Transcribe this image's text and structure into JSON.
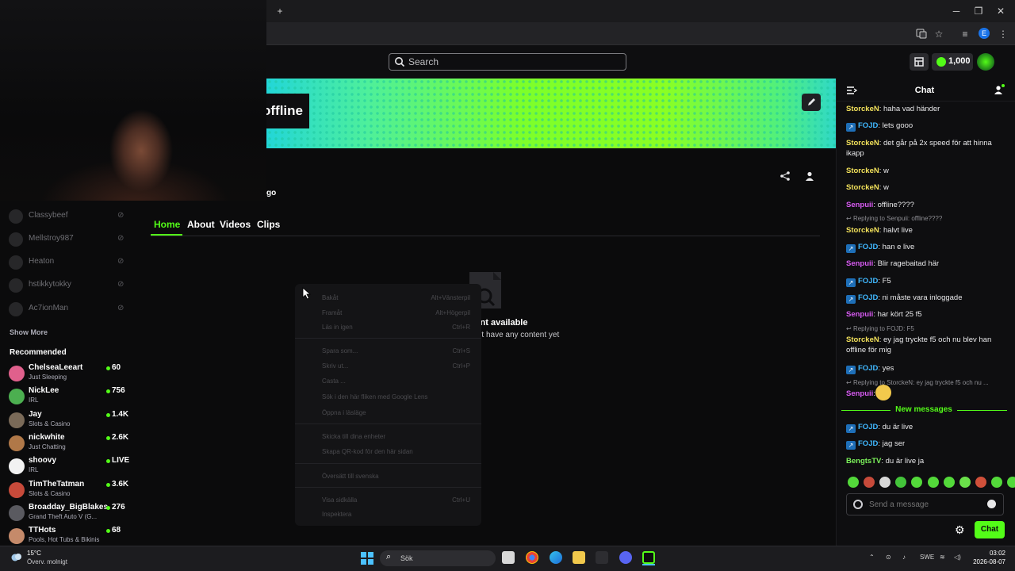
{
  "browser": {
    "new_tab": "+",
    "min": "─",
    "max": "❐",
    "close": "✕",
    "profile_initial": "E"
  },
  "header": {
    "search_placeholder": "Search",
    "balance": "1,000"
  },
  "channel": {
    "offline_label": "offline",
    "about_fragment": "go",
    "tabs": [
      "Home",
      "About",
      "Videos",
      "Clips"
    ],
    "empty_title": "No content available",
    "empty_subtitle": "This channel doesn't have any content yet"
  },
  "context_menu": {
    "items": [
      {
        "label": "Bakåt",
        "shortcut": "Alt+Vänsterpil"
      },
      {
        "label": "Framåt",
        "shortcut": "Alt+Högerpil"
      },
      {
        "label": "Läs in igen",
        "shortcut": "Ctrl+R"
      },
      {
        "label": "Spara som...",
        "shortcut": "Ctrl+S"
      },
      {
        "label": "Skriv ut...",
        "shortcut": "Ctrl+P"
      },
      {
        "label": "Casta ...",
        "shortcut": ""
      },
      {
        "label": "Sök i den här fliken med Google Lens",
        "shortcut": ""
      },
      {
        "label": "Öppna i läsläge",
        "shortcut": ""
      },
      {
        "label": "Skicka till dina enheter",
        "shortcut": ""
      },
      {
        "label": "Skapa QR-kod för den här sidan",
        "shortcut": ""
      },
      {
        "label": "Översätt till svenska",
        "shortcut": ""
      },
      {
        "label": "Visa sidkälla",
        "shortcut": "Ctrl+U"
      },
      {
        "label": "Inspektera",
        "shortcut": ""
      }
    ]
  },
  "sidebar": {
    "following": [
      {
        "name": "Classybeef"
      },
      {
        "name": "Mellstroy987"
      },
      {
        "name": "Heaton"
      },
      {
        "name": "hstikkytokky"
      },
      {
        "name": "Ac7ionMan"
      }
    ],
    "show_more": "Show More",
    "recommended_title": "Recommended",
    "recommended": [
      {
        "name": "ChelseaLeeart",
        "category": "Just Sleeping",
        "viewers": "60",
        "color": "#e0608c"
      },
      {
        "name": "NickLee",
        "category": "IRL",
        "viewers": "756",
        "color": "#4caf50"
      },
      {
        "name": "Jay",
        "category": "Slots & Casino",
        "viewers": "1.4K",
        "color": "#7a6a58"
      },
      {
        "name": "nickwhite",
        "category": "Just Chatting",
        "viewers": "2.6K",
        "color": "#b07848"
      },
      {
        "name": "shoovy",
        "category": "IRL",
        "viewers": "LIVE",
        "color": "#f2f2f2"
      },
      {
        "name": "TimTheTatman",
        "category": "Slots & Casino",
        "viewers": "3.6K",
        "color": "#c74a3a"
      },
      {
        "name": "Broadday_BigBlakes",
        "category": "Grand Theft Auto V (G...",
        "viewers": "276",
        "color": "#5a5a60"
      },
      {
        "name": "TTHots",
        "category": "Pools, Hot Tubs & Bikinis",
        "viewers": "68",
        "color": "#c58a6a"
      }
    ]
  },
  "chat": {
    "title": "Chat",
    "messages": [
      {
        "user": "StorckeN",
        "color": "#f2e15b",
        "text": "haha vad händer",
        "badge": false
      },
      {
        "user": "FOJD",
        "color": "#40b8ff",
        "text": "lets gooo",
        "badge": true
      },
      {
        "user": "StorckeN",
        "color": "#f2e15b",
        "text": "det går på 2x speed för att hinna ikapp",
        "badge": false
      },
      {
        "user": "StorckeN",
        "color": "#f2e15b",
        "text": "w",
        "badge": false
      },
      {
        "user": "StorckeN",
        "color": "#f2e15b",
        "text": "w",
        "badge": false
      },
      {
        "user": "Senpuii",
        "color": "#d85bf2",
        "text": "offline????",
        "badge": false
      },
      {
        "user": "StorckeN",
        "color": "#f2e15b",
        "text": "halvt live",
        "badge": false
      },
      {
        "user": "FOJD",
        "color": "#40b8ff",
        "text": "han e live",
        "badge": true
      },
      {
        "user": "Senpuii",
        "color": "#d85bf2",
        "text": "Blir ragebaitad här",
        "badge": false
      },
      {
        "user": "FOJD",
        "color": "#40b8ff",
        "text": "F5",
        "badge": true
      },
      {
        "user": "FOJD",
        "color": "#40b8ff",
        "text": "ni måste vara inloggade",
        "badge": true
      },
      {
        "user": "Senpuii",
        "color": "#d85bf2",
        "text": "har kört 25 f5",
        "badge": false
      },
      {
        "user": "StorckeN",
        "color": "#f2e15b",
        "text": "ey jag tryckte f5 och nu blev han offline för mig",
        "badge": false
      },
      {
        "user": "FOJD",
        "color": "#40b8ff",
        "text": "yes",
        "badge": true
      },
      {
        "user": "Senpuii",
        "color": "#d85bf2",
        "text": "",
        "badge": false
      },
      {
        "user": "FOJD",
        "color": "#40b8ff",
        "text": "du är live",
        "badge": true
      },
      {
        "user": "FOJD",
        "color": "#40b8ff",
        "text": "jag ser",
        "badge": true
      },
      {
        "user": "BengtsTV",
        "color": "#7cf25b",
        "text": "du är live ja",
        "badge": false
      }
    ],
    "replies": [
      "Replying to Senpuii: offline????",
      "Replying to FOJD: F5",
      "Replying to StorckeN: ey jag tryckte f5 och nu ..."
    ],
    "new_messages": "New messages",
    "input_placeholder": "Send a message",
    "send_label": "Chat"
  },
  "taskbar": {
    "weather_temp": "15°C",
    "weather_desc": "Överv. molnigt",
    "search_label": "Sök",
    "lang": "SWE",
    "time": "03:02",
    "date": "2026-08-07"
  },
  "colors": {
    "accent": "#53fc18",
    "brand_bg": "#0e0e10"
  }
}
